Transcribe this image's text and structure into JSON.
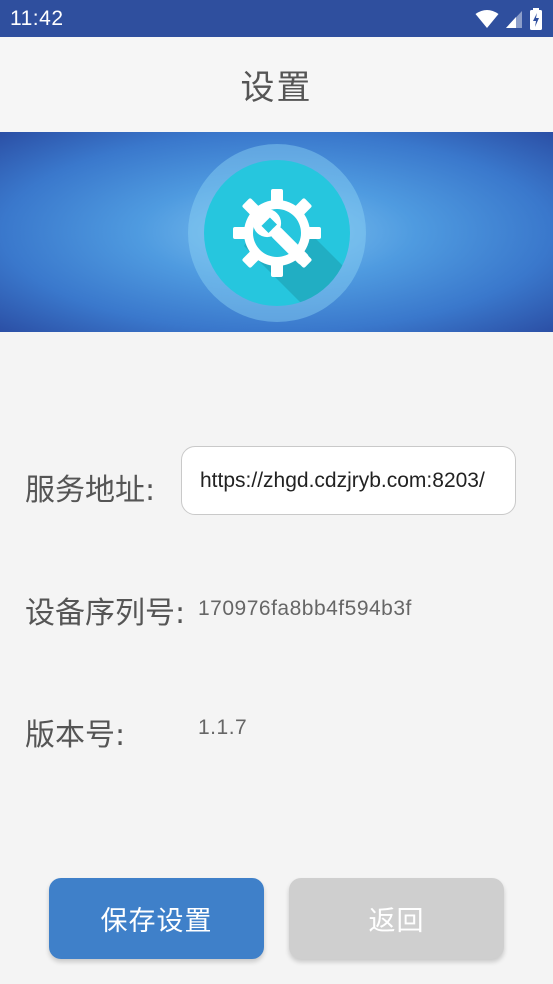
{
  "status_bar": {
    "time": "11:42",
    "icons": [
      "wifi-icon",
      "cell-signal-icon",
      "battery-charging-icon"
    ]
  },
  "header": {
    "title": "设置"
  },
  "banner": {
    "icon": "settings-wrench-gear-icon",
    "colors": {
      "background_center": "#7dc0ef",
      "background_edge": "#2b4fa5",
      "circle": "#26c6de"
    }
  },
  "form": {
    "server_address": {
      "label": "服务地址:",
      "value": "https://zhgd.cdzjryb.com:8203/"
    },
    "device_serial": {
      "label": "设备序列号:",
      "value": "170976fa8bb4f594b3f"
    },
    "version": {
      "label": "版本号:",
      "value": "1.1.7"
    }
  },
  "actions": {
    "save_label": "保存设置",
    "back_label": "返回",
    "colors": {
      "save": "#3f80c9",
      "back": "#cfcfcf"
    }
  }
}
